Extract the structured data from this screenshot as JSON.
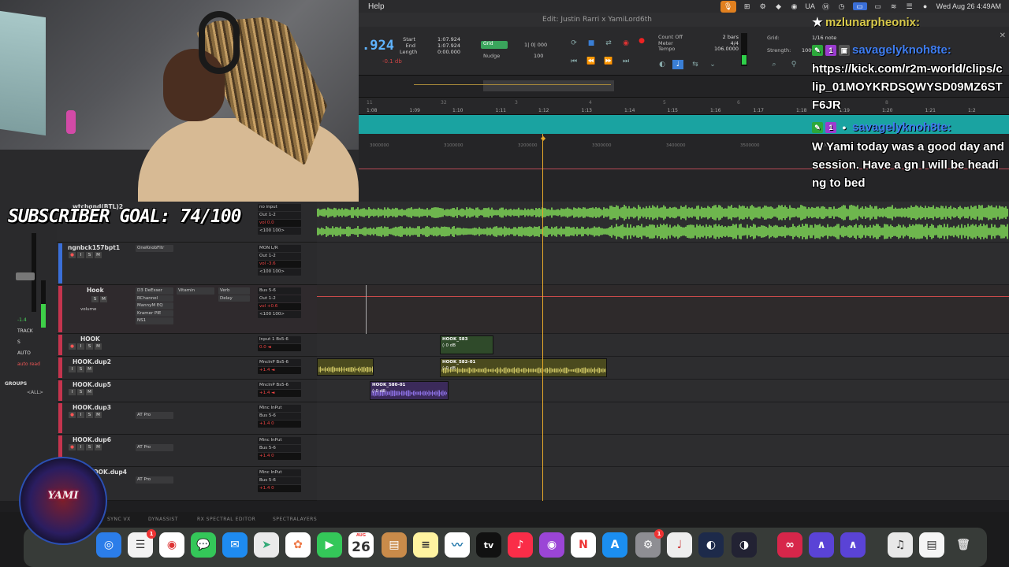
{
  "overlay": {
    "subscriber_goal": "SUBSCRIBER GOAL: 74/100",
    "logo_text": "YAMI"
  },
  "menubar": {
    "help_label": "Help",
    "date_time": "Wed Aug 26  4:49AM",
    "ua_label": "UA"
  },
  "edit_window": {
    "title": "Edit: Justin Rarri x YamiLord6th",
    "counter_main": ".924",
    "counter_sub": "-0.1 db",
    "selection_labels": "Start\nEnd\nLength",
    "selection_values": "1:07.924\n1:07.924\n0:00.000",
    "grid_label": "Grid",
    "grid_value": "1| 0| 000",
    "nudge_label": "Nudge",
    "nudge_value": "100",
    "count_off_label": "Count Off",
    "count_off_value": "2 bars",
    "meter_label": "Meter",
    "meter_value": "4/4",
    "tempo_label": "Tempo",
    "tempo_value": "106.0000",
    "grid_ctl_label": "Grid:",
    "grid_note": "1/16 note",
    "strength_label": "Strength:",
    "strength_value": "100%"
  },
  "ruler": {
    "bars": [
      "11",
      "32",
      "3",
      "4",
      "5",
      "6",
      "7",
      "8"
    ],
    "times": [
      "1:08",
      "1:09",
      "1:10",
      "1:11",
      "1:12",
      "1:13",
      "1:14",
      "1:15",
      "1:16",
      "1:17",
      "1:18",
      "1:19",
      "1:20",
      "1:21",
      "1:2"
    ],
    "samples": [
      "3000000",
      "3100000",
      "3200000",
      "3300000",
      "3400000",
      "3500000",
      "3600000"
    ]
  },
  "chat": [
    {
      "user": "mzlunarpheonix:",
      "badges": [
        "star"
      ],
      "text": ""
    },
    {
      "user": "savagelyknoh8te:",
      "badges": [
        "mod",
        "first",
        "gift"
      ],
      "text": "https://kick.com/r2m-world/clips/clip_01MOYKRDSQWYSD09MZ6STF6JR"
    },
    {
      "user": "savagelyknoh8te:",
      "badges": [
        "mod",
        "first",
        "drop"
      ],
      "text": "W Yami today was a good day and session. Have a gn I will be heading to bed"
    }
  ],
  "mixer": {
    "fader_value": "-1.4",
    "track_label": "TRACK",
    "s_label": "S",
    "auto_label": "AUTO",
    "auto_read": "auto read",
    "groups_label": "GROUPS",
    "groups_all": "<ALL>"
  },
  "tracks": [
    {
      "name": "wtchgnd(BTL)2",
      "inserts": [
        "",
        ""
      ],
      "io": [
        "no input",
        "Out 1-2",
        "vol  0.0",
        "<100  100>"
      ]
    },
    {
      "name": "ngnbck157bpt1",
      "inserts": [
        "OneKnobFltr"
      ],
      "io": [
        "MON L/R",
        "Out 1-2",
        "vol  -3.6",
        "<100  100>"
      ],
      "mode": "wave"
    },
    {
      "name": "Hook",
      "inserts": [
        "D3 DeEsser",
        "RChannel",
        "MannyM EQ",
        "Kramer PIE",
        "NS1"
      ],
      "inserts2": [
        "Vitamin",
        "Verb",
        "Delay"
      ],
      "io": [
        "Bus 5-6",
        "Out 1-2",
        "vol  +0.6",
        "<100  100>"
      ],
      "mode": "volume"
    },
    {
      "name": "HOOK",
      "io": [
        "Input 1  Bs5-6",
        "0.0  ◄"
      ],
      "mode": "wave"
    },
    {
      "name": "HOOK.dup2",
      "io": [
        "MncInP  Bs5-6",
        "+1.4  ◄"
      ],
      "mode": "wave"
    },
    {
      "name": "HOOK.dup5",
      "io": [
        "MncInP  Bs5-6",
        "+1.4  ◄"
      ],
      "mode": "wave"
    },
    {
      "name": "HOOK.dup3",
      "inserts": [
        "AT Pro"
      ],
      "io": [
        "Minc InPut",
        "Bus 5-6",
        "+1.4   0"
      ],
      "mode": "wave"
    },
    {
      "name": "HOOK.dup6",
      "inserts": [
        "AT Pro"
      ],
      "io": [
        "Minc InPut",
        "Bus 5-6",
        "+1.4   0"
      ],
      "mode": "wave"
    },
    {
      "name": "HOOK.dup4",
      "inserts": [
        "AT Pro"
      ],
      "io": [
        "Minc InPut",
        "Bus 5-6",
        "+1.4   0"
      ],
      "mode": "wave"
    }
  ],
  "clips": [
    {
      "name": "HOOK_583",
      "gain": "◊ 0 dB"
    },
    {
      "name": "HOOK_582-01",
      "gain": "◊ 0 dB"
    },
    {
      "name": "HOOK_580-01",
      "gain": "◊ 0 dB"
    }
  ],
  "bottom_plugins": [
    "SYNC VX",
    "DYNASSIST",
    "RX SPECTRAL EDITOR",
    "SPECTRALAYERS"
  ],
  "dock": {
    "calendar_month": "AUG",
    "calendar_day": "26",
    "reminders_badge": "1",
    "settings_badge": "1",
    "appletv_label": "tv"
  },
  "colors": {
    "accent_blue": "#5fb4ff",
    "marker_teal": "#1aa3a1",
    "waveform_green": "#7ed957",
    "clip_olive": "#4a4a1e",
    "clip_purple": "#3b2a5a",
    "playhead": "#e7a92a",
    "track_red": "#c5344e"
  }
}
